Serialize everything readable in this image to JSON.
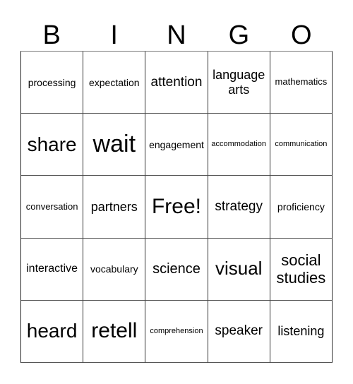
{
  "header": {
    "letters": [
      "B",
      "I",
      "N",
      "G",
      "O"
    ]
  },
  "cells": [
    [
      "processing",
      "expectation",
      "attention",
      "language arts",
      "mathematics"
    ],
    [
      "share",
      "wait",
      "engagement",
      "accommodation",
      "communication"
    ],
    [
      "conversation",
      "partners",
      "Free!",
      "strategy",
      "proficiency"
    ],
    [
      "interactive",
      "vocabulary",
      "science",
      "visual",
      "social studies"
    ],
    [
      "heard",
      "retell",
      "comprehension",
      "speaker",
      "listening"
    ]
  ]
}
